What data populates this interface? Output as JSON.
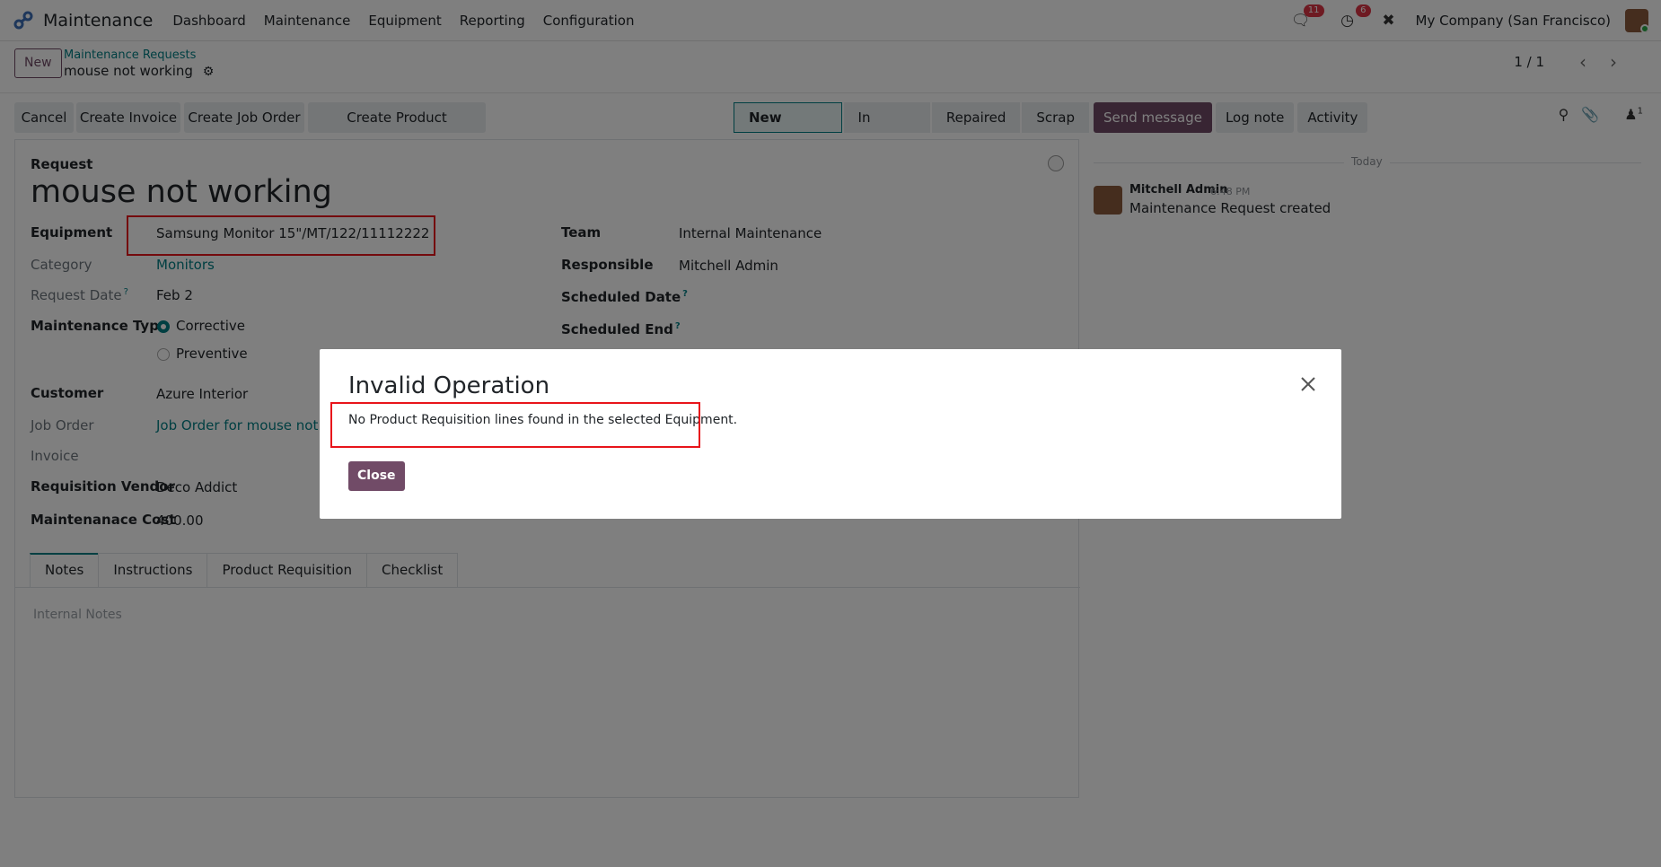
{
  "navbar": {
    "app_name": "Maintenance",
    "menu": [
      "Dashboard",
      "Maintenance",
      "Equipment",
      "Reporting",
      "Configuration"
    ],
    "messages_count": "11",
    "activities_count": "6",
    "company": "My Company (San Francisco)"
  },
  "control_panel": {
    "new_label": "New",
    "breadcrumb": "Maintenance Requests",
    "record_name": "mouse not working",
    "pager": "1 / 1"
  },
  "actions": {
    "cancel": "Cancel",
    "create_invoice": "Create Invoice",
    "create_job_order": "Create Job Order",
    "create_product_requisition": "Create Product Requisition"
  },
  "stages": [
    "New Request",
    "In Progress",
    "Repaired",
    "Scrap"
  ],
  "chatter": {
    "send_message": "Send message",
    "log_note": "Log note",
    "activity": "Activity",
    "followers_count": "1",
    "date_separator": "Today",
    "author": "Mitchell Admin",
    "time": "6:48 PM",
    "message": "Maintenance Request created"
  },
  "form": {
    "request_label": "Request",
    "title": "mouse not working",
    "equipment_label": "Equipment",
    "equipment": "Samsung Monitor 15\"/MT/122/11112222",
    "category_label": "Category",
    "category": "Monitors",
    "request_date_label": "Request Date",
    "request_date": "Feb 2",
    "maintenance_type_label": "Maintenance Type",
    "type_corrective": "Corrective",
    "type_preventive": "Preventive",
    "customer_label": "Customer",
    "customer": "Azure Interior",
    "job_order_label": "Job Order",
    "job_order": "Job Order for mouse not working",
    "invoice_label": "Invoice",
    "requisition_vendor_label": "Requisition Vendor",
    "requisition_vendor": "Deco Addict",
    "maintenance_cost_label": "Maintenanace Cost",
    "maintenance_cost": "400.00",
    "team_label": "Team",
    "team": "Internal Maintenance",
    "responsible_label": "Responsible",
    "responsible": "Mitchell Admin",
    "scheduled_date_label": "Scheduled Date",
    "scheduled_end_label": "Scheduled End",
    "help_mark": "?",
    "tabs": [
      "Notes",
      "Instructions",
      "Product Requisition",
      "Checklist"
    ],
    "notes_placeholder": "Internal Notes"
  },
  "dialog": {
    "title": "Invalid Operation",
    "body": "No Product Requisition lines found in the selected Equipment.",
    "close": "Close"
  },
  "colors": {
    "brand": "#714b67",
    "accent": "#017e84",
    "annotation": "#e8141b"
  }
}
